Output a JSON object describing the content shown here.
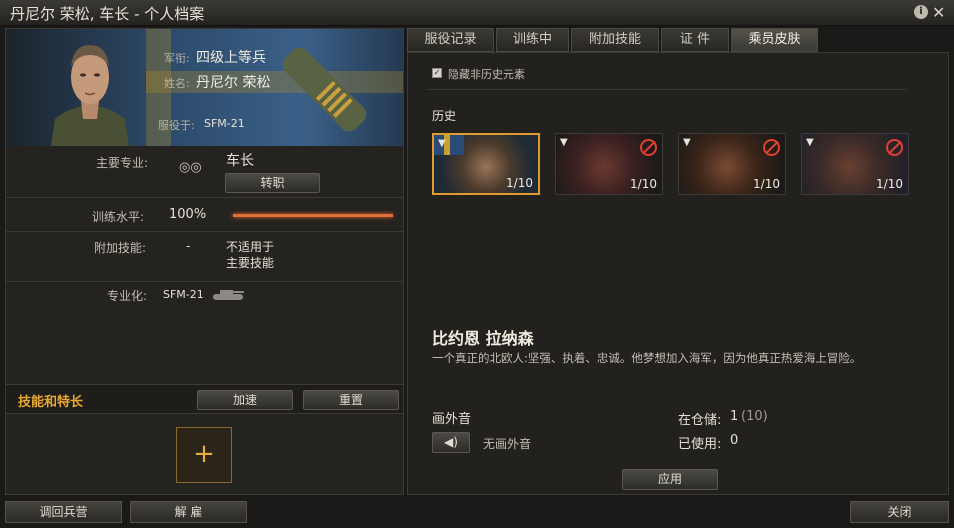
{
  "window": {
    "title": "丹尼尔 荣松, 车长 - 个人档案",
    "info_icon": "info-icon",
    "close_icon": "close-icon"
  },
  "profile": {
    "rank_label": "军衔:",
    "rank_value": "四级上等兵",
    "name_label": "姓名:",
    "name_value": "丹尼尔 荣松",
    "served_label": "服役于:",
    "served_value": "SFM-21"
  },
  "details": {
    "primary_label": "主要专业:",
    "primary_value": "车长",
    "retrain_button": "转职",
    "training_label": "训练水平:",
    "training_value": "100%",
    "training_fraction": 1.0,
    "extra_label": "附加技能:",
    "extra_value": "-",
    "extra_note1": "不适用于",
    "extra_note2": "主要技能",
    "spec_label": "专业化:",
    "spec_value": "SFM-21"
  },
  "skills": {
    "title": "技能和特长",
    "accelerate_button": "加速",
    "reset_button": "重置",
    "add_symbol": "+"
  },
  "bottom": {
    "barracks_button": "调回兵营",
    "dismiss_button": "解 雇",
    "close_button": "关闭"
  },
  "tabs": [
    "服役记录",
    "训练中",
    "附加技能",
    "证 件",
    "乘员皮肤"
  ],
  "skins_panel": {
    "hide_nonhistoric": "隐藏非历史元素",
    "history_label": "历史",
    "skins": [
      {
        "count": "1/10",
        "selected": true,
        "banned": false
      },
      {
        "count": "1/10",
        "selected": false,
        "banned": true
      },
      {
        "count": "1/10",
        "selected": false,
        "banned": true
      },
      {
        "count": "1/10",
        "selected": false,
        "banned": true
      }
    ],
    "skin_name": "比约恩 拉纳森",
    "skin_desc": "一个真正的北欧人:坚强、执着、忠诚。他梦想加入海军，因为他真正热爱海上冒险。",
    "voiceover_label": "画外音",
    "voiceover_value": "无画外音",
    "stock_label": "在仓储:",
    "stock_value": "1",
    "stock_total": "(10)",
    "used_label": "已使用:",
    "used_value": "0",
    "apply_button": "应用"
  },
  "colors": {
    "accent": "#e09a30",
    "ban": "#e04030",
    "bar": "#e0703a"
  }
}
